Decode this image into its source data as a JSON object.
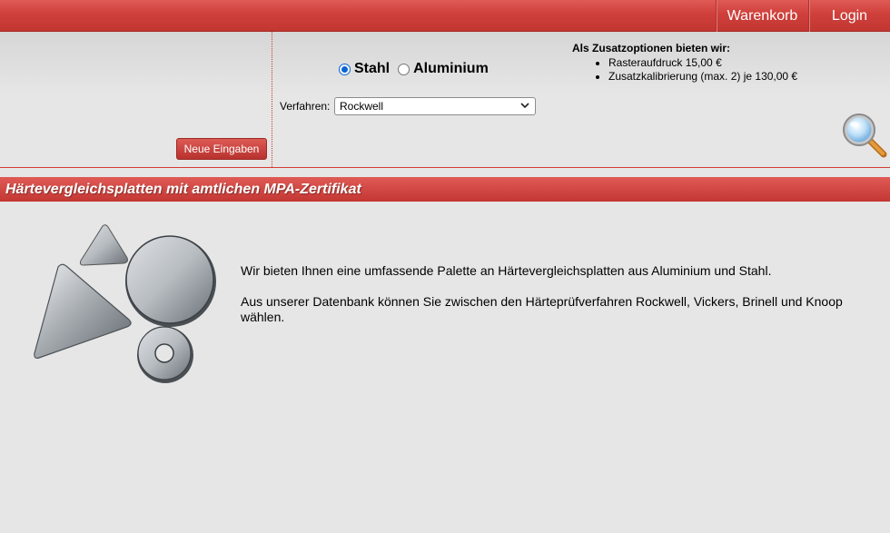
{
  "nav": {
    "cart_label": "Warenkorb",
    "login_label": "Login"
  },
  "filter": {
    "reset_label": "Neue Eingaben",
    "material": {
      "options": [
        "Stahl",
        "Aluminium"
      ],
      "selected": "Stahl"
    },
    "method": {
      "label": "Verfahren:",
      "value": "Rockwell"
    },
    "extras": {
      "title": "Als Zusatzoptionen bieten wir:",
      "items": [
        "Rasteraufdruck 15,00 €",
        "Zusatzkalibrierung (max. 2) je 130,00 €"
      ]
    }
  },
  "section": {
    "title": "Härtevergleichsplatten mit amtlichen MPA-Zertifikat"
  },
  "content": {
    "paragraphs": [
      "Wir bieten Ihnen eine umfassende Palette an Härtevergleichsplatten aus Aluminium und Stahl.",
      "Aus unserer Datenbank können Sie zwischen den Härteprüfverfahren Rockwell, Vickers, Brinell und Knoop wählen."
    ]
  },
  "colors": {
    "brand_red": "#cf403b",
    "accent_blue": "#0a64d2"
  },
  "icons": [
    "search-icon",
    "chevron-down-icon",
    "radio-checked-icon",
    "radio-unchecked-icon"
  ]
}
